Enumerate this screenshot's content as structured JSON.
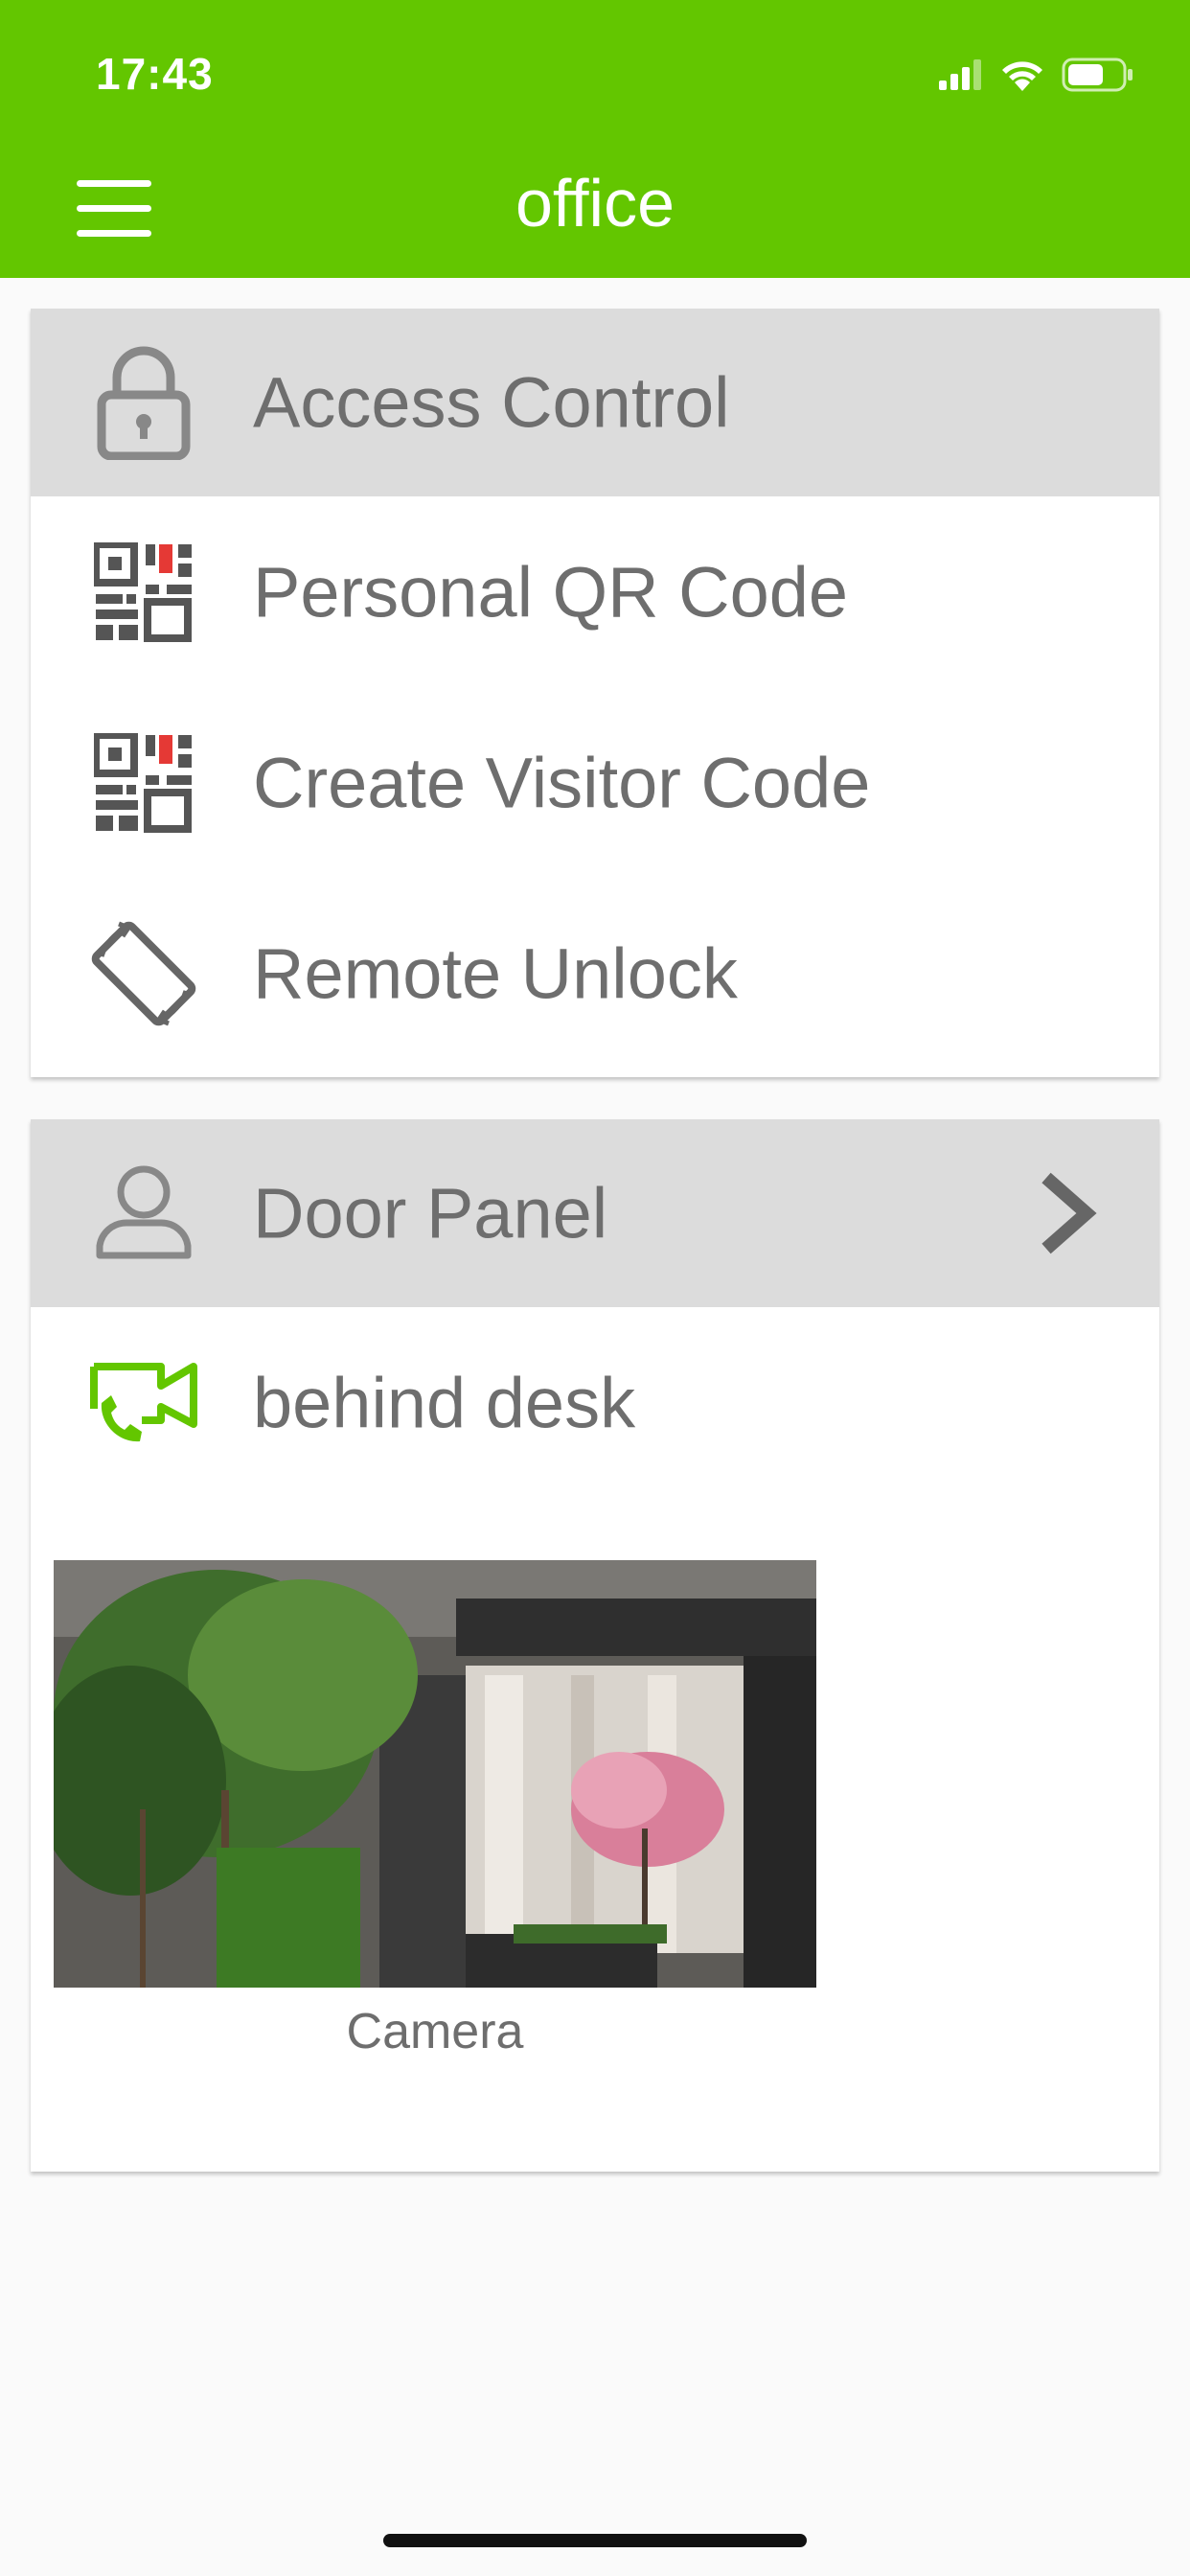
{
  "status_bar": {
    "time": "17:43"
  },
  "header": {
    "title": "office",
    "color": "#63c600"
  },
  "access_control": {
    "title": "Access Control",
    "items": [
      {
        "label": "Personal QR Code",
        "icon": "qr-code-icon"
      },
      {
        "label": "Create Visitor Code",
        "icon": "qr-code-icon"
      },
      {
        "label": "Remote Unlock",
        "icon": "rotate-device-icon"
      }
    ]
  },
  "door_panel": {
    "title": "Door Panel",
    "items": [
      {
        "label": "behind desk",
        "icon": "video-call-icon"
      }
    ],
    "camera": {
      "label": "Camera"
    }
  }
}
